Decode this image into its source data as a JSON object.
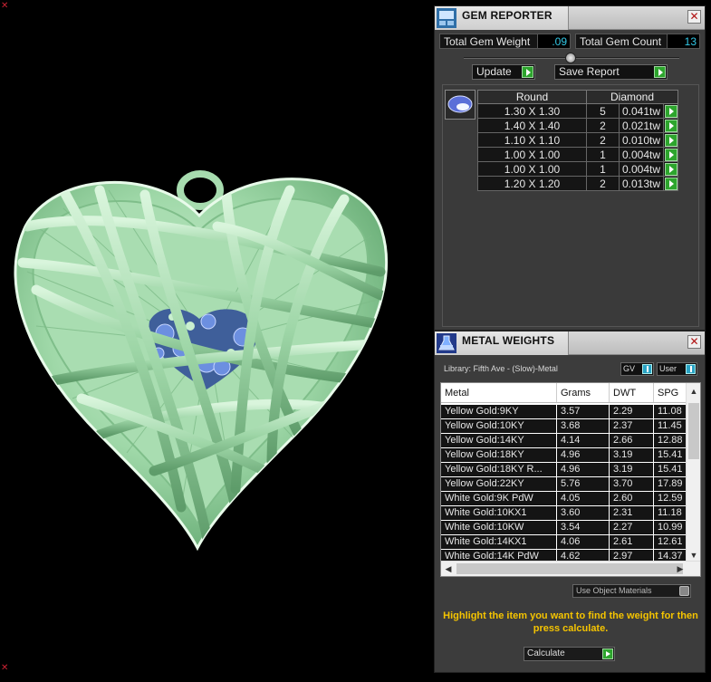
{
  "gem_reporter": {
    "title": "GEM REPORTER",
    "total_weight_label": "Total Gem Weight",
    "total_weight_value": ".09",
    "total_count_label": "Total Gem Count",
    "total_count_value": "13",
    "update_label": "Update",
    "save_report_label": "Save Report",
    "table": {
      "headers": [
        "Round",
        "Diamond"
      ],
      "rows": [
        {
          "size": "1.30 X 1.30",
          "count": "5",
          "weight": "0.041tw"
        },
        {
          "size": "1.40 X 1.40",
          "count": "2",
          "weight": "0.021tw"
        },
        {
          "size": "1.10 X 1.10",
          "count": "2",
          "weight": "0.010tw"
        },
        {
          "size": "1.00 X 1.00",
          "count": "1",
          "weight": "0.004tw"
        },
        {
          "size": "1.00 X 1.00",
          "count": "1",
          "weight": "0.004tw"
        },
        {
          "size": "1.20 X 1.20",
          "count": "2",
          "weight": "0.013tw"
        }
      ]
    }
  },
  "metal_weights": {
    "title": "METAL WEIGHTS",
    "library": "Library: Fifth Ave - (Slow)-Metal",
    "gv_label": "GV",
    "user_label": "User",
    "columns": [
      "Metal",
      "Grams",
      "DWT",
      "SPG"
    ],
    "rows": [
      {
        "metal": "Yellow Gold:9KY",
        "grams": "3.57",
        "dwt": "2.29",
        "spg": "11.08"
      },
      {
        "metal": "Yellow Gold:10KY",
        "grams": "3.68",
        "dwt": "2.37",
        "spg": "11.45"
      },
      {
        "metal": "Yellow Gold:14KY",
        "grams": "4.14",
        "dwt": "2.66",
        "spg": "12.88"
      },
      {
        "metal": "Yellow Gold:18KY",
        "grams": "4.96",
        "dwt": "3.19",
        "spg": "15.41"
      },
      {
        "metal": "Yellow Gold:18KY R...",
        "grams": "4.96",
        "dwt": "3.19",
        "spg": "15.41"
      },
      {
        "metal": "Yellow Gold:22KY",
        "grams": "5.76",
        "dwt": "3.70",
        "spg": "17.89"
      },
      {
        "metal": "White Gold:9K PdW",
        "grams": "4.05",
        "dwt": "2.60",
        "spg": "12.59"
      },
      {
        "metal": "White Gold:10KX1",
        "grams": "3.60",
        "dwt": "2.31",
        "spg": "11.18"
      },
      {
        "metal": "White Gold:10KW",
        "grams": "3.54",
        "dwt": "2.27",
        "spg": "10.99"
      },
      {
        "metal": "White Gold:14KX1",
        "grams": "4.06",
        "dwt": "2.61",
        "spg": "12.61"
      },
      {
        "metal": "White Gold:14K PdW",
        "grams": "4.62",
        "dwt": "2.97",
        "spg": "14.37"
      }
    ],
    "use_object_materials": "Use Object Materials",
    "hint": "Highlight the item you want to find the weight for then press calculate.",
    "calculate_label": "Calculate"
  },
  "colors": {
    "pendant": "#9fd8a8",
    "gem": "#5a7fd6",
    "value_text": "#32c8e6",
    "hint_text": "#f5c400",
    "go_button": "#2da52d"
  }
}
